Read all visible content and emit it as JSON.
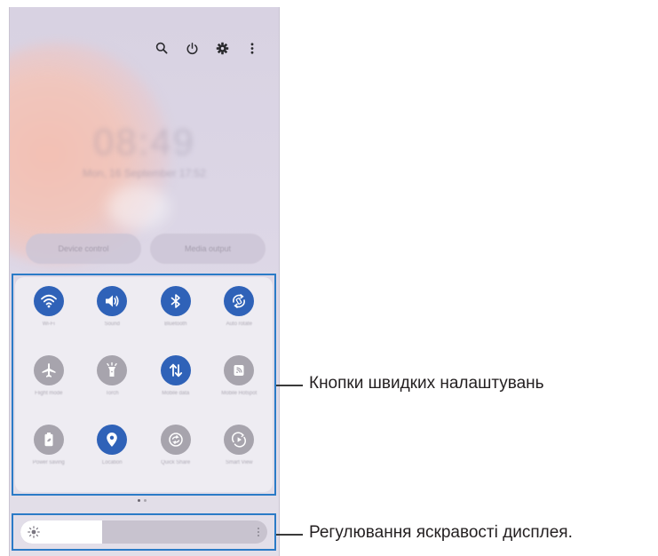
{
  "status": {
    "clock": "08:49",
    "date": "Mon, 16 September 17:52"
  },
  "topbar": {
    "icons": [
      "search-icon",
      "power-icon",
      "gear-icon",
      "more-vertical-icon"
    ]
  },
  "buttons": {
    "device_control": "Device control",
    "media_output": "Media output"
  },
  "quick_settings": [
    {
      "label": "Wi-Fi",
      "icon": "wifi-icon",
      "state": "on"
    },
    {
      "label": "Sound",
      "icon": "sound-icon",
      "state": "on"
    },
    {
      "label": "Bluetooth",
      "icon": "bluetooth-icon",
      "state": "on"
    },
    {
      "label": "Auto rotate",
      "icon": "rotate-icon",
      "state": "on"
    },
    {
      "label": "Flight mode",
      "icon": "airplane-icon",
      "state": "off"
    },
    {
      "label": "Torch",
      "icon": "flashlight-icon",
      "state": "off"
    },
    {
      "label": "Mobile data",
      "icon": "mobile-data-icon",
      "state": "on"
    },
    {
      "label": "Mobile Hotspot",
      "icon": "hotspot-icon",
      "state": "off"
    },
    {
      "label": "Power saving",
      "icon": "battery-icon",
      "state": "off"
    },
    {
      "label": "Location",
      "icon": "location-icon",
      "state": "on"
    },
    {
      "label": "Quick Share",
      "icon": "sync-icon",
      "state": "off"
    },
    {
      "label": "Smart View",
      "icon": "smart-view-icon",
      "state": "off"
    }
  ],
  "brightness": {
    "level": 0.33
  },
  "colors": {
    "accent": "#2f62b8",
    "callout_border": "#2b7bc7",
    "inactive": "#a7a4ad"
  },
  "callouts": {
    "quick_settings": "Кнопки швидких налаштувань",
    "brightness": "Регулювання яскравості дисплея."
  }
}
